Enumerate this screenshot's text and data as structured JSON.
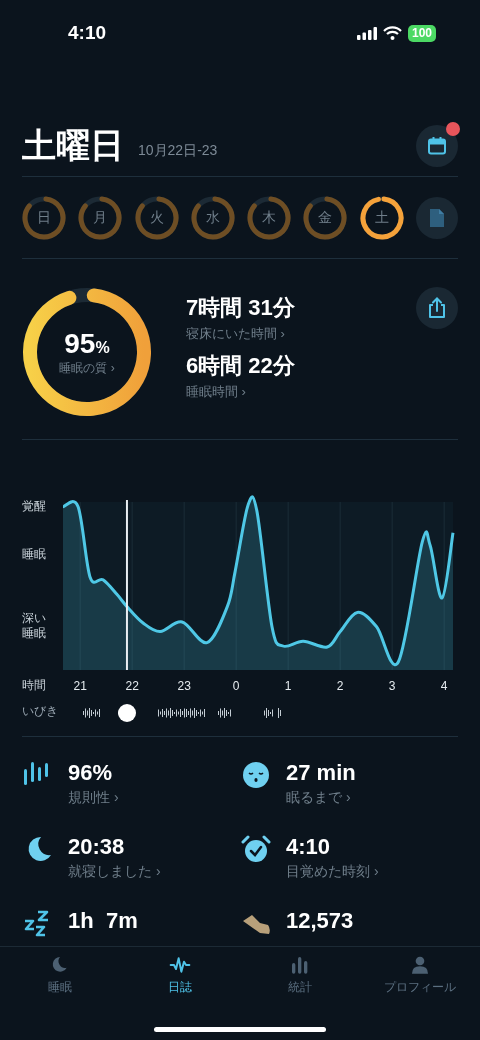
{
  "status_bar": {
    "time": "4:10",
    "battery": "100"
  },
  "header": {
    "title": "土曜日",
    "date": "10月22日-23",
    "calendar_notification": true
  },
  "days": [
    {
      "label": "日",
      "selected": false
    },
    {
      "label": "月",
      "selected": false
    },
    {
      "label": "火",
      "selected": false
    },
    {
      "label": "水",
      "selected": false
    },
    {
      "label": "木",
      "selected": false
    },
    {
      "label": "金",
      "selected": false
    },
    {
      "label": "土",
      "selected": true
    }
  ],
  "quality": {
    "value": "95",
    "unit": "%",
    "label": "睡眠の質 ›"
  },
  "durations": [
    {
      "value": "7時間 31分",
      "label": "寝床にいた時間 ›"
    },
    {
      "value": "6時間 22分",
      "label": "睡眠時間 ›"
    }
  ],
  "sleep_chart": {
    "stage_labels": [
      "覚醒",
      "睡眠",
      "深い睡眠"
    ],
    "time_label": "時間",
    "time_ticks": [
      "21",
      "22",
      "23",
      "0",
      "1",
      "2",
      "3",
      "4"
    ],
    "snore_label": "いびき"
  },
  "stats": [
    {
      "kind": "regularity",
      "value": "96%",
      "label": "規則性 ›"
    },
    {
      "kind": "latency",
      "value": "27 min",
      "label": "眠るまで ›"
    },
    {
      "kind": "bedtime",
      "value": "20:38",
      "label": "就寝しました ›"
    },
    {
      "kind": "wakeup",
      "value": "4:10",
      "label": "目覚めた時刻 ›"
    },
    {
      "kind": "snoring",
      "value": "1h  7m"
    },
    {
      "kind": "steps",
      "value": "12,573"
    }
  ],
  "tabs": [
    {
      "kind": "sleep",
      "label": "睡眠",
      "selected": false
    },
    {
      "kind": "journal",
      "label": "日誌",
      "selected": true
    },
    {
      "kind": "stats",
      "label": "統計",
      "selected": false
    },
    {
      "kind": "profile",
      "label": "プロフィール",
      "selected": false
    }
  ]
}
